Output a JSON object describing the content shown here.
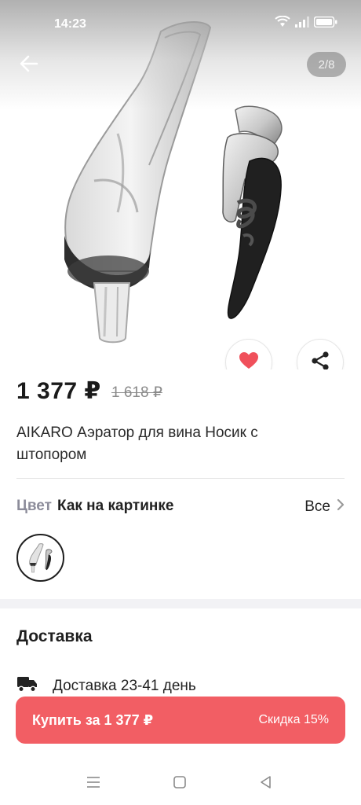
{
  "status_bar": {
    "time": "14:23",
    "icons": [
      "wifi-icon",
      "signal-icon",
      "battery-icon"
    ]
  },
  "gallery": {
    "counter": "2/8",
    "image": "wine-aerator-and-corkscrew-photo"
  },
  "product": {
    "price": "1 377 ₽",
    "old_price": "1 618 ₽",
    "title": "AIKARO Аэратор для вина Носик с штопором"
  },
  "color": {
    "label": "Цвет",
    "value": "Как на картинке",
    "all_link": "Все"
  },
  "delivery": {
    "heading": "Доставка",
    "info": "Доставка 23-41 день",
    "icon": "truck-icon"
  },
  "buy": {
    "label": "Купить за 1 377 ₽",
    "discount": "Скидка 15%"
  },
  "colors": {
    "accent": "#f25e64",
    "heart": "#f0505b",
    "muted_text": "#8c8c9a"
  },
  "nav": {
    "icons": [
      "menu-icon",
      "home-icon",
      "back-triangle-icon"
    ]
  }
}
